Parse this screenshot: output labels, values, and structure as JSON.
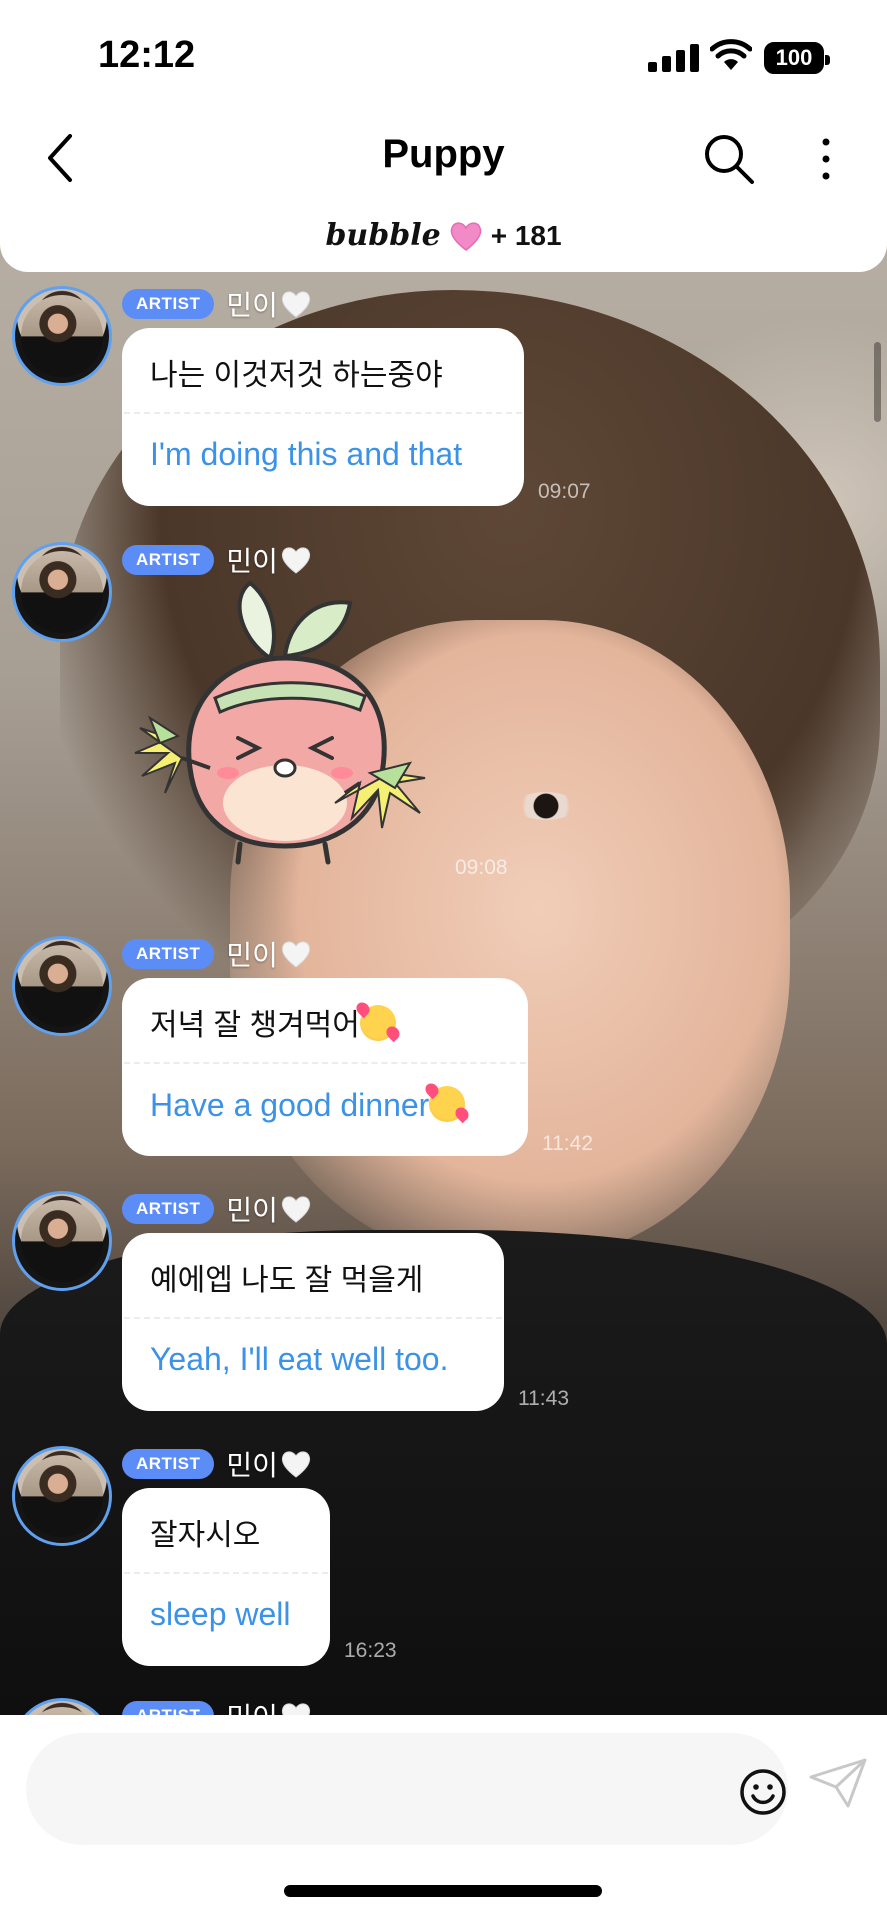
{
  "status_bar": {
    "time": "12:12",
    "battery": "100"
  },
  "header": {
    "title": "Puppy",
    "bubble_logo": "bubble",
    "subscriber_count": "+ 181"
  },
  "colors": {
    "accent": "#3b92e6",
    "badge": "#5c8df7",
    "avatar_ring": "#5fa0ef"
  },
  "messages": [
    {
      "badge": "ARTIST",
      "sender": "민이",
      "ko": "나는 이것저것 하는중야",
      "en": "I'm doing this and that",
      "time": "09:07"
    },
    {
      "badge": "ARTIST",
      "sender": "민이",
      "type": "sticker",
      "sticker": "peach-cheerleader-sticker",
      "time": "09:08"
    },
    {
      "badge": "ARTIST",
      "sender": "민이",
      "ko": "저녁 잘 챙겨먹어",
      "en": "Have a good dinner",
      "emoji": "smiling-face-with-hearts",
      "time": "11:42"
    },
    {
      "badge": "ARTIST",
      "sender": "민이",
      "ko": "예에엡 나도 잘 먹을게",
      "en": "Yeah, I'll eat well too.",
      "time": "11:43"
    },
    {
      "badge": "ARTIST",
      "sender": "민이",
      "ko": "잘자시오",
      "en": "sleep well",
      "time": "16:23"
    },
    {
      "badge": "ARTIST",
      "sender": "민이"
    }
  ],
  "composer": {
    "placeholder": ""
  }
}
